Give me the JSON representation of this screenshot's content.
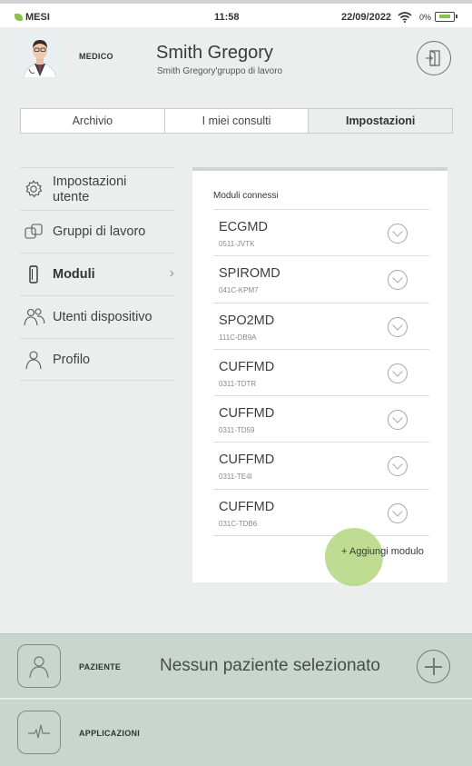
{
  "status_bar": {
    "carrier": "MESI",
    "time": "11:58",
    "date": "22/09/2022",
    "battery": "0%"
  },
  "header": {
    "role": "MEDICO",
    "name": "Smith Gregory",
    "group": "Smith Gregory'gruppo di lavoro"
  },
  "tabs": [
    {
      "label": "Archivio"
    },
    {
      "label": "I miei consulti"
    },
    {
      "label": "Impostazioni"
    }
  ],
  "sidebar": {
    "items": [
      {
        "label": "Impostazioni utente",
        "icon": "gear-icon"
      },
      {
        "label": "Gruppi di lavoro",
        "icon": "group-icon"
      },
      {
        "label": "Moduli",
        "icon": "module-icon"
      },
      {
        "label": "Utenti dispositivo",
        "icon": "users-icon"
      },
      {
        "label": "Profilo",
        "icon": "profile-icon"
      }
    ]
  },
  "modules_panel": {
    "title": "Moduli connessi",
    "modules": [
      {
        "name": "ECGMD",
        "code": "0511-JVTK"
      },
      {
        "name": "SPIROMD",
        "code": "041C-KPM7"
      },
      {
        "name": "SPO2MD",
        "code": "111C-DB9A"
      },
      {
        "name": "CUFFMD",
        "code": "0311-TDTR"
      },
      {
        "name": "CUFFMD",
        "code": "0311-TD59"
      },
      {
        "name": "CUFFMD",
        "code": "0311-TE4I"
      },
      {
        "name": "CUFFMD",
        "code": "031C-TDB6"
      }
    ],
    "add_label": "+ Aggiungi modulo"
  },
  "patient_bar": {
    "label": "PAZIENTE",
    "status": "Nessun paziente selezionato"
  },
  "apps_bar": {
    "label": "APPLICAZIONI"
  },
  "colors": {
    "background": "#eceeee",
    "accent_green": "#8bc34a",
    "bottom_bar": "#c9d6cf"
  }
}
